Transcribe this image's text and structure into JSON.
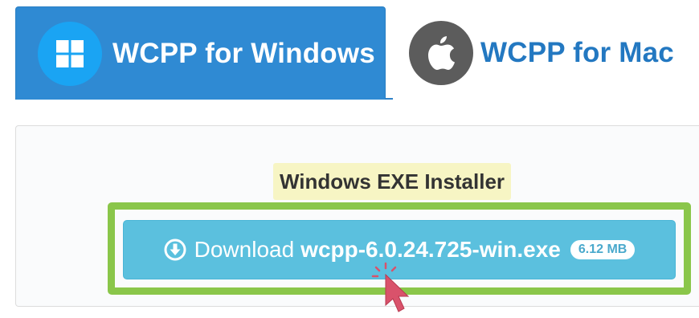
{
  "tabs": [
    {
      "label": "WCPP for Windows",
      "icon": "windows-logo-icon",
      "active": true
    },
    {
      "label": "WCPP for Mac",
      "icon": "apple-logo-icon",
      "active": false
    }
  ],
  "panel": {
    "heading": "Windows EXE Installer",
    "download": {
      "prefix": "Download",
      "filename": "wcpp-6.0.24.725-win.exe",
      "size": "6.12 MB",
      "icon": "download-circle-icon"
    }
  },
  "colors": {
    "tab_active_bg": "#2f8ad3",
    "tab_inactive_text": "#2378c1",
    "button_bg": "#5bc0de",
    "highlight_border": "#8ac64a",
    "heading_highlight": "#f7f5c4",
    "cursor": "#d9526b"
  }
}
